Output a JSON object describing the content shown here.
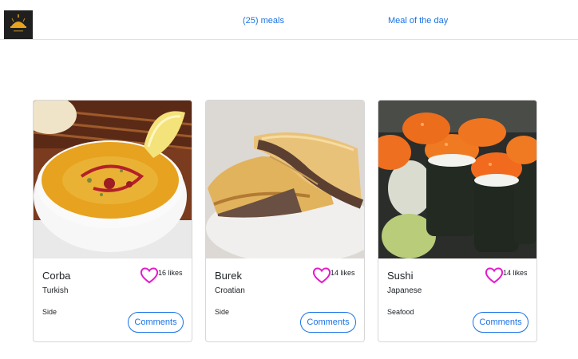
{
  "nav": {
    "logo_icon": "food-logo-icon",
    "meals_link": "(25) meals",
    "meal_of_day_link": "Meal of the day"
  },
  "colors": {
    "accent": "#1a73e8",
    "heart": "#e619cc",
    "border": "#d7d7d7"
  },
  "meals": [
    {
      "title": "Corba",
      "area": "Turkish",
      "category": "Side",
      "likes": "16 likes",
      "comments_label": "Comments",
      "image": "corba-soup-photo"
    },
    {
      "title": "Burek",
      "area": "Croatian",
      "category": "Side",
      "likes": "14 likes",
      "comments_label": "Comments",
      "image": "burek-pastry-photo"
    },
    {
      "title": "Sushi",
      "area": "Japanese",
      "category": "Seafood",
      "likes": "14 likes",
      "comments_label": "Comments",
      "image": "sushi-rolls-photo"
    }
  ]
}
